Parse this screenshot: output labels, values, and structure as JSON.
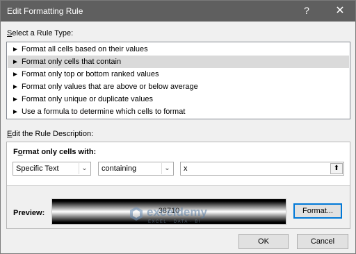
{
  "window": {
    "title": "Edit Formatting Rule",
    "help_glyph": "?",
    "close_glyph": "✕"
  },
  "rule_type": {
    "label_accel": "S",
    "label_rest": "elect a Rule Type:",
    "bullet": "►",
    "items": [
      {
        "label": "Format all cells based on their values",
        "selected": false
      },
      {
        "label": "Format only cells that contain",
        "selected": true
      },
      {
        "label": "Format only top or bottom ranked values",
        "selected": false
      },
      {
        "label": "Format only values that are above or below average",
        "selected": false
      },
      {
        "label": "Format only unique or duplicate values",
        "selected": false
      },
      {
        "label": "Use a formula to determine which cells to format",
        "selected": false
      }
    ]
  },
  "description": {
    "label_accel": "E",
    "label_rest": "dit the Rule Description:",
    "heading_accel": "o",
    "heading_pre": "F",
    "heading_post": "rmat only cells with:",
    "condition_type": {
      "value": "Specific Text",
      "drop_icon": "chevron-down-icon"
    },
    "operator": {
      "value": "containing",
      "drop_icon": "chevron-down-icon"
    },
    "text_value": "x",
    "collapse_icon": "collapse-dialog-icon",
    "collapse_glyph": "⬆",
    "drop_glyph": "⌄",
    "preview_label": "Preview:",
    "preview_text": "38710",
    "format_button": "Format..."
  },
  "buttons": {
    "ok": "OK",
    "cancel": "Cancel"
  },
  "watermark": {
    "name": "exceldemy",
    "tagline": "EXCEL · DATA · BI"
  },
  "colors": {
    "titlebar": "#5f5f5f",
    "dialog_bg": "#f0f0f0",
    "selected_row": "#dadada",
    "focus_border": "#0078d7"
  }
}
